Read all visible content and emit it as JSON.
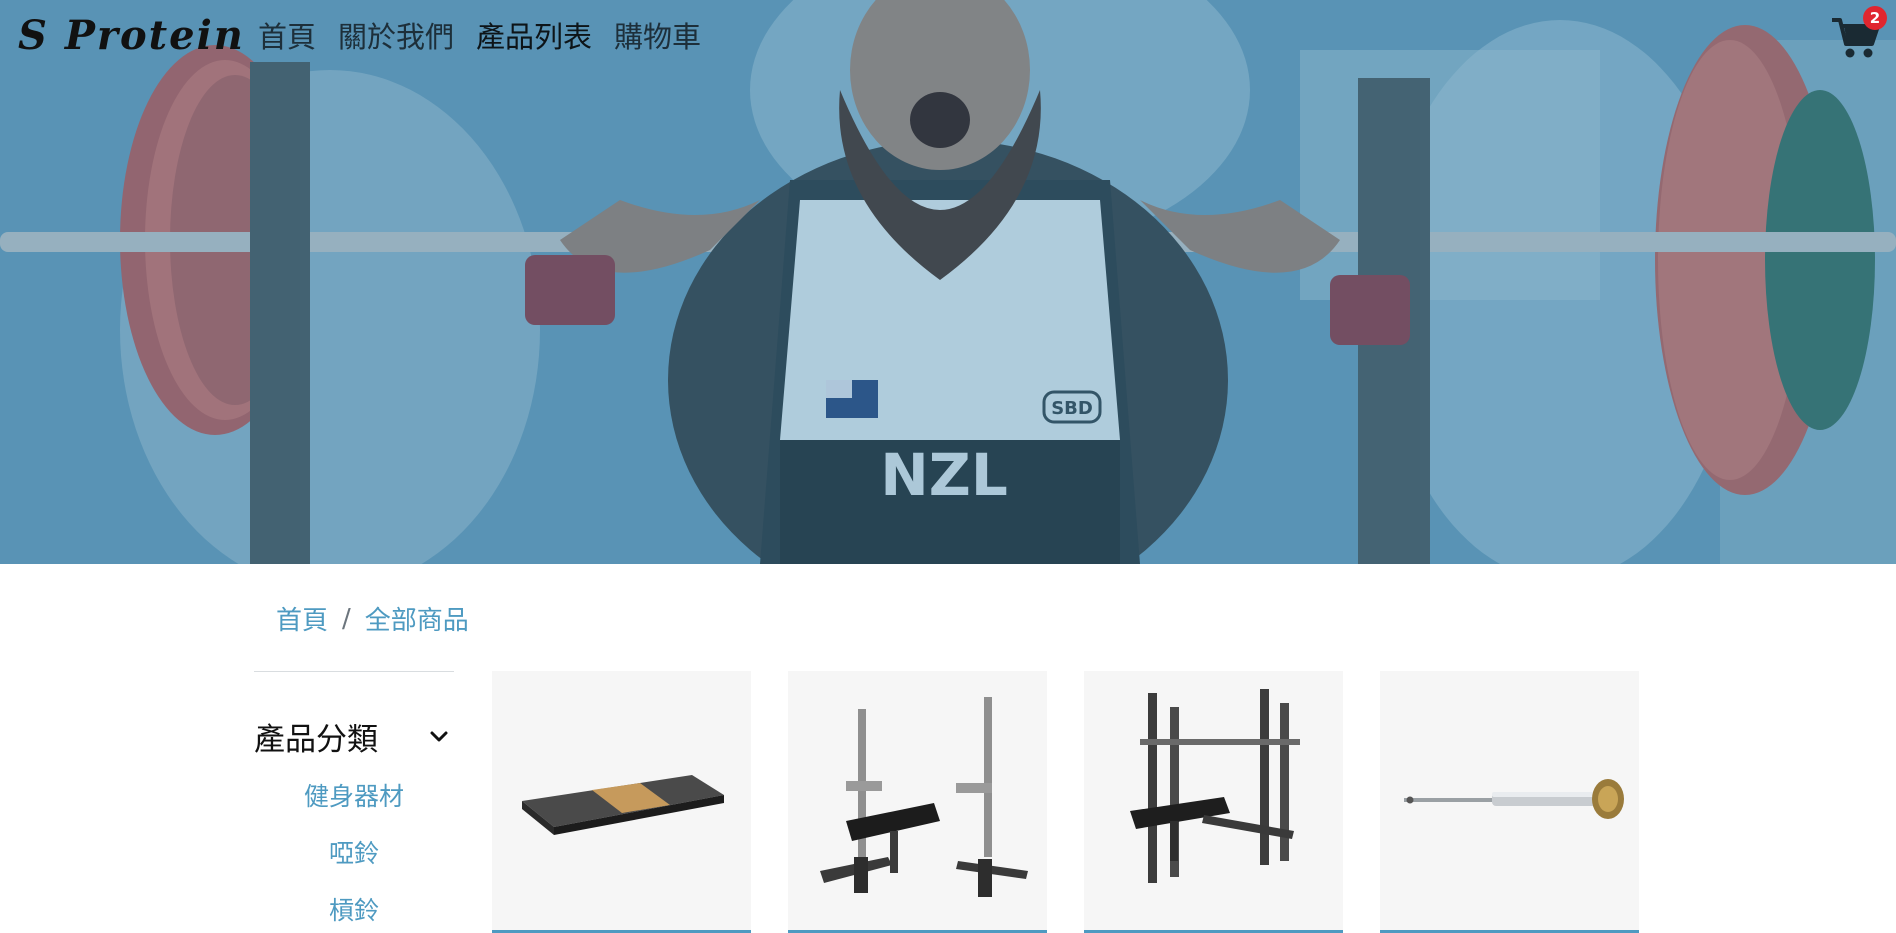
{
  "nav": {
    "brand": "S Protein",
    "links": [
      "首頁",
      "關於我們",
      "產品列表",
      "購物車"
    ],
    "cart_count": "2",
    "cart_icon": "shopping-cart-icon"
  },
  "hero": {
    "jersey_text": "NZL",
    "sponsor_text": "SBD"
  },
  "breadcrumb": {
    "home": "首頁",
    "current": "全部商品"
  },
  "sidebar": {
    "title": "產品分類",
    "toggle_icon": "chevron-down-icon",
    "categories": [
      "健身器材",
      "啞鈴",
      "槓鈴"
    ]
  },
  "colors": {
    "accent": "#4e9ac1",
    "badge": "#e0262f",
    "card_bg": "#f6f6f6"
  }
}
